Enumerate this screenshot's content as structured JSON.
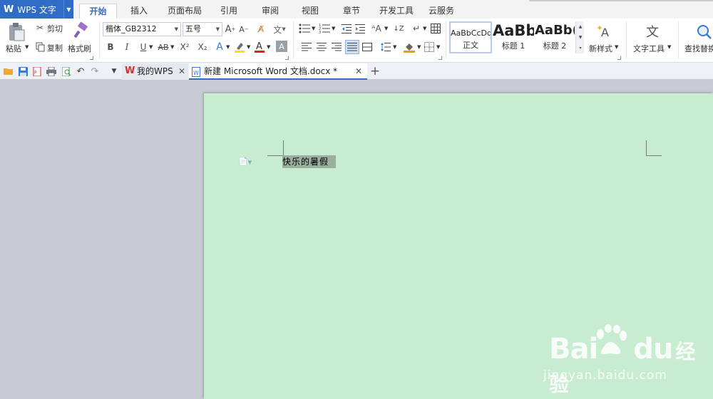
{
  "app": {
    "logo": "W",
    "name": "WPS 文字"
  },
  "ribbon_tabs": [
    "开始",
    "插入",
    "页面布局",
    "引用",
    "审阅",
    "视图",
    "章节",
    "开发工具",
    "云服务"
  ],
  "active_tab": "开始",
  "clipboard": {
    "paste": "粘贴",
    "cut": "剪切",
    "copy": "复制",
    "format_painter": "格式刷"
  },
  "font": {
    "name": "楷体_GB2312",
    "size": "五号"
  },
  "font_buttons": {
    "bold": "B",
    "italic": "I",
    "underline": "U",
    "strike": "AB",
    "superscript": "X²",
    "subscript": "X₂"
  },
  "styles": [
    {
      "sample": "AaBbCcDd",
      "name": "正文"
    },
    {
      "sample": "AaBb",
      "name": "标题 1"
    },
    {
      "sample": "AaBb(",
      "name": "标题 2"
    }
  ],
  "new_style": "新样式",
  "text_tools": "文字工具",
  "find_replace": "查找替换",
  "doc_tabs": [
    {
      "label": "我的WPS",
      "active": false
    },
    {
      "label": "新建 Microsoft Word 文档.docx *",
      "active": true
    }
  ],
  "document": {
    "selected_text": "快乐的暑假"
  },
  "watermark": {
    "brand": "Bai",
    "brand_suffix": "du",
    "brand_cn": "经验",
    "url": "jingyan.baidu.com"
  },
  "colors": {
    "accent": "#2f6cc6",
    "page_bg": "#c8ecd0",
    "selection": "#9aaf9e",
    "workspace": "#c7cbd4"
  }
}
